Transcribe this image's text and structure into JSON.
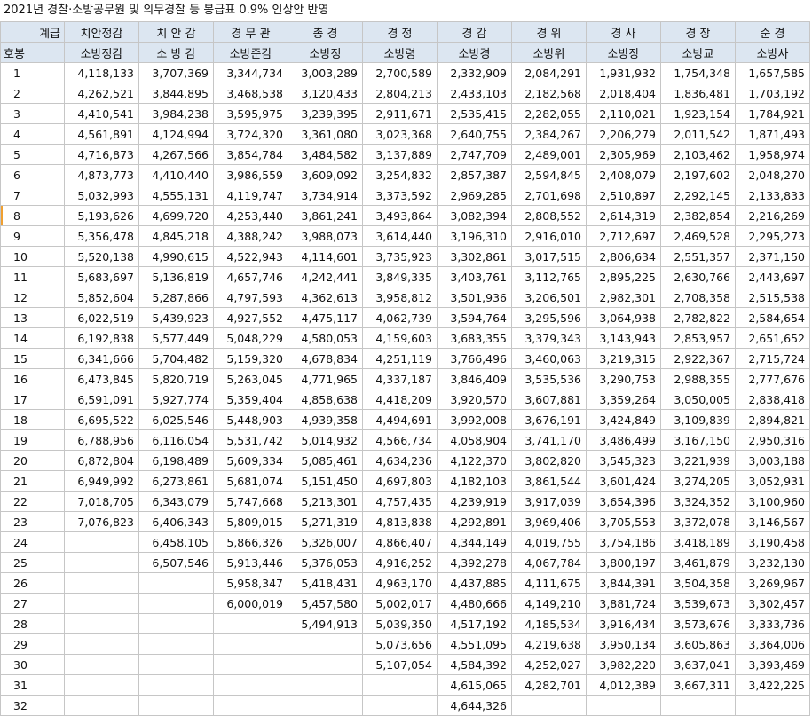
{
  "title": "2021년 경찰·소방공무원 및 의무경찰 등 봉급표 0.9% 인상안 반영",
  "header": {
    "corner_top": "계급",
    "corner_bottom": "호봉",
    "police_ranks": [
      "치안정감",
      "치 안 감",
      "경 무 관",
      "총 경",
      "경 정",
      "경 감",
      "경 위",
      "경 사",
      "경 장",
      "순 경"
    ],
    "fire_ranks": [
      "소방정감",
      "소 방 감",
      "소방준감",
      "소방정",
      "소방령",
      "소방경",
      "소방위",
      "소방장",
      "소방교",
      "소방사"
    ]
  },
  "rows": [
    {
      "step": "1",
      "values": [
        "4,118,133",
        "3,707,369",
        "3,344,734",
        "3,003,289",
        "2,700,589",
        "2,332,909",
        "2,084,291",
        "1,931,932",
        "1,754,348",
        "1,657,585"
      ]
    },
    {
      "step": "2",
      "values": [
        "4,262,521",
        "3,844,895",
        "3,468,538",
        "3,120,433",
        "2,804,213",
        "2,433,103",
        "2,182,568",
        "2,018,404",
        "1,836,481",
        "1,703,192"
      ]
    },
    {
      "step": "3",
      "values": [
        "4,410,541",
        "3,984,238",
        "3,595,975",
        "3,239,395",
        "2,911,671",
        "2,535,415",
        "2,282,055",
        "2,110,021",
        "1,923,154",
        "1,784,921"
      ]
    },
    {
      "step": "4",
      "values": [
        "4,561,891",
        "4,124,994",
        "3,724,320",
        "3,361,080",
        "3,023,368",
        "2,640,755",
        "2,384,267",
        "2,206,279",
        "2,011,542",
        "1,871,493"
      ]
    },
    {
      "step": "5",
      "values": [
        "4,716,873",
        "4,267,566",
        "3,854,784",
        "3,484,582",
        "3,137,889",
        "2,747,709",
        "2,489,001",
        "2,305,969",
        "2,103,462",
        "1,958,974"
      ]
    },
    {
      "step": "6",
      "values": [
        "4,873,773",
        "4,410,440",
        "3,986,559",
        "3,609,092",
        "3,254,832",
        "2,857,387",
        "2,594,845",
        "2,408,079",
        "2,197,602",
        "2,048,270"
      ]
    },
    {
      "step": "7",
      "values": [
        "5,032,993",
        "4,555,131",
        "4,119,747",
        "3,734,914",
        "3,373,592",
        "2,969,285",
        "2,701,698",
        "2,510,897",
        "2,292,145",
        "2,133,833"
      ]
    },
    {
      "step": "8",
      "values": [
        "5,193,626",
        "4,699,720",
        "4,253,440",
        "3,861,241",
        "3,493,864",
        "3,082,394",
        "2,808,552",
        "2,614,319",
        "2,382,854",
        "2,216,269"
      ]
    },
    {
      "step": "9",
      "values": [
        "5,356,478",
        "4,845,218",
        "4,388,242",
        "3,988,073",
        "3,614,440",
        "3,196,310",
        "2,916,010",
        "2,712,697",
        "2,469,528",
        "2,295,273"
      ]
    },
    {
      "step": "10",
      "values": [
        "5,520,138",
        "4,990,615",
        "4,522,943",
        "4,114,601",
        "3,735,923",
        "3,302,861",
        "3,017,515",
        "2,806,634",
        "2,551,357",
        "2,371,150"
      ]
    },
    {
      "step": "11",
      "values": [
        "5,683,697",
        "5,136,819",
        "4,657,746",
        "4,242,441",
        "3,849,335",
        "3,403,761",
        "3,112,765",
        "2,895,225",
        "2,630,766",
        "2,443,697"
      ]
    },
    {
      "step": "12",
      "values": [
        "5,852,604",
        "5,287,866",
        "4,797,593",
        "4,362,613",
        "3,958,812",
        "3,501,936",
        "3,206,501",
        "2,982,301",
        "2,708,358",
        "2,515,538"
      ]
    },
    {
      "step": "13",
      "values": [
        "6,022,519",
        "5,439,923",
        "4,927,552",
        "4,475,117",
        "4,062,739",
        "3,594,764",
        "3,295,596",
        "3,064,938",
        "2,782,822",
        "2,584,654"
      ]
    },
    {
      "step": "14",
      "values": [
        "6,192,838",
        "5,577,449",
        "5,048,229",
        "4,580,053",
        "4,159,603",
        "3,683,355",
        "3,379,343",
        "3,143,943",
        "2,853,957",
        "2,651,652"
      ]
    },
    {
      "step": "15",
      "values": [
        "6,341,666",
        "5,704,482",
        "5,159,320",
        "4,678,834",
        "4,251,119",
        "3,766,496",
        "3,460,063",
        "3,219,315",
        "2,922,367",
        "2,715,724"
      ]
    },
    {
      "step": "16",
      "values": [
        "6,473,845",
        "5,820,719",
        "5,263,045",
        "4,771,965",
        "4,337,187",
        "3,846,409",
        "3,535,536",
        "3,290,753",
        "2,988,355",
        "2,777,676"
      ]
    },
    {
      "step": "17",
      "values": [
        "6,591,091",
        "5,927,774",
        "5,359,404",
        "4,858,638",
        "4,418,209",
        "3,920,570",
        "3,607,881",
        "3,359,264",
        "3,050,005",
        "2,838,418"
      ]
    },
    {
      "step": "18",
      "values": [
        "6,695,522",
        "6,025,546",
        "5,448,903",
        "4,939,358",
        "4,494,691",
        "3,992,008",
        "3,676,191",
        "3,424,849",
        "3,109,839",
        "2,894,821"
      ]
    },
    {
      "step": "19",
      "values": [
        "6,788,956",
        "6,116,054",
        "5,531,742",
        "5,014,932",
        "4,566,734",
        "4,058,904",
        "3,741,170",
        "3,486,499",
        "3,167,150",
        "2,950,316"
      ]
    },
    {
      "step": "20",
      "values": [
        "6,872,804",
        "6,198,489",
        "5,609,334",
        "5,085,461",
        "4,634,236",
        "4,122,370",
        "3,802,820",
        "3,545,323",
        "3,221,939",
        "3,003,188"
      ]
    },
    {
      "step": "21",
      "values": [
        "6,949,992",
        "6,273,861",
        "5,681,074",
        "5,151,450",
        "4,697,803",
        "4,182,103",
        "3,861,544",
        "3,601,424",
        "3,274,205",
        "3,052,931"
      ]
    },
    {
      "step": "22",
      "values": [
        "7,018,705",
        "6,343,079",
        "5,747,668",
        "5,213,301",
        "4,757,435",
        "4,239,919",
        "3,917,039",
        "3,654,396",
        "3,324,352",
        "3,100,960"
      ]
    },
    {
      "step": "23",
      "values": [
        "7,076,823",
        "6,406,343",
        "5,809,015",
        "5,271,319",
        "4,813,838",
        "4,292,891",
        "3,969,406",
        "3,705,553",
        "3,372,078",
        "3,146,567"
      ]
    },
    {
      "step": "24",
      "values": [
        "",
        "6,458,105",
        "5,866,326",
        "5,326,007",
        "4,866,407",
        "4,344,149",
        "4,019,755",
        "3,754,186",
        "3,418,189",
        "3,190,458"
      ]
    },
    {
      "step": "25",
      "values": [
        "",
        "6,507,546",
        "5,913,446",
        "5,376,053",
        "4,916,252",
        "4,392,278",
        "4,067,784",
        "3,800,197",
        "3,461,879",
        "3,232,130"
      ]
    },
    {
      "step": "26",
      "values": [
        "",
        "",
        "5,958,347",
        "5,418,431",
        "4,963,170",
        "4,437,885",
        "4,111,675",
        "3,844,391",
        "3,504,358",
        "3,269,967"
      ]
    },
    {
      "step": "27",
      "values": [
        "",
        "",
        "6,000,019",
        "5,457,580",
        "5,002,017",
        "4,480,666",
        "4,149,210",
        "3,881,724",
        "3,539,673",
        "3,302,457"
      ]
    },
    {
      "step": "28",
      "values": [
        "",
        "",
        "",
        "5,494,913",
        "5,039,350",
        "4,517,192",
        "4,185,534",
        "3,916,434",
        "3,573,676",
        "3,333,736"
      ]
    },
    {
      "step": "29",
      "values": [
        "",
        "",
        "",
        "",
        "5,073,656",
        "4,551,095",
        "4,219,638",
        "3,950,134",
        "3,605,863",
        "3,364,006"
      ]
    },
    {
      "step": "30",
      "values": [
        "",
        "",
        "",
        "",
        "5,107,054",
        "4,584,392",
        "4,252,027",
        "3,982,220",
        "3,637,041",
        "3,393,469"
      ]
    },
    {
      "step": "31",
      "values": [
        "",
        "",
        "",
        "",
        "",
        "4,615,065",
        "4,282,701",
        "4,012,389",
        "3,667,311",
        "3,422,225"
      ]
    },
    {
      "step": "32",
      "values": [
        "",
        "",
        "",
        "",
        "",
        "4,644,326",
        "",
        "",
        "",
        ""
      ]
    }
  ]
}
